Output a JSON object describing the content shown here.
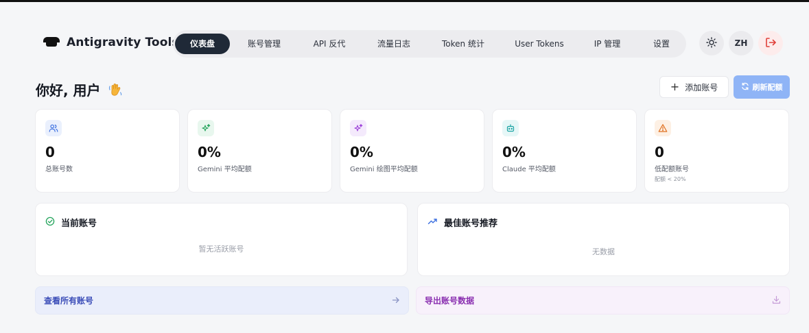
{
  "app": {
    "title": "Antigravity Tools"
  },
  "nav": {
    "tabs": [
      {
        "label": "仪表盘",
        "active": true
      },
      {
        "label": "账号管理",
        "active": false
      },
      {
        "label": "API 反代",
        "active": false
      },
      {
        "label": "流量日志",
        "active": false
      },
      {
        "label": "Token 统计",
        "active": false
      },
      {
        "label": "User Tokens",
        "active": false
      },
      {
        "label": "IP 管理",
        "active": false
      },
      {
        "label": "设置",
        "active": false
      }
    ],
    "theme_icon": "sun-icon",
    "language": "ZH",
    "logout_icon": "logout-icon"
  },
  "greeting": {
    "text": "你好, 用户",
    "icon": "waving-hand-icon"
  },
  "actions": {
    "add_account": "添加账号",
    "refresh_quota": "刷新配额"
  },
  "stats": [
    {
      "value": "0",
      "label": "总账号数",
      "sub": "",
      "icon": "users-icon",
      "color": "#3b6fe0",
      "bg": "#eaf0fd"
    },
    {
      "value": "0%",
      "label": "Gemini 平均配额",
      "sub": "",
      "icon": "sparkles-icon",
      "color": "#22a35a",
      "bg": "#e8f7ee"
    },
    {
      "value": "0%",
      "label": "Gemini 绘图平均配额",
      "sub": "",
      "icon": "sparkles-icon",
      "color": "#9b3ed8",
      "bg": "#f4eafc"
    },
    {
      "value": "0%",
      "label": "Claude 平均配额",
      "sub": "",
      "icon": "bot-icon",
      "color": "#1aa3a3",
      "bg": "#e6f7f7"
    },
    {
      "value": "0",
      "label": "低配额账号",
      "sub": "配额 < 20%",
      "icon": "warning-icon",
      "color": "#e07020",
      "bg": "#fdf0e4"
    }
  ],
  "panels": {
    "current": {
      "title": "当前账号",
      "empty": "暂无活跃账号",
      "icon": "check-circle-icon",
      "color": "#22a35a"
    },
    "best": {
      "title": "最佳账号推荐",
      "empty": "无数据",
      "icon": "trending-up-icon",
      "color": "#3b6fe0"
    }
  },
  "links": {
    "view_all": {
      "label": "查看所有账号",
      "icon": "arrow-right-icon"
    },
    "export": {
      "label": "导出账号数据",
      "icon": "download-icon"
    }
  }
}
